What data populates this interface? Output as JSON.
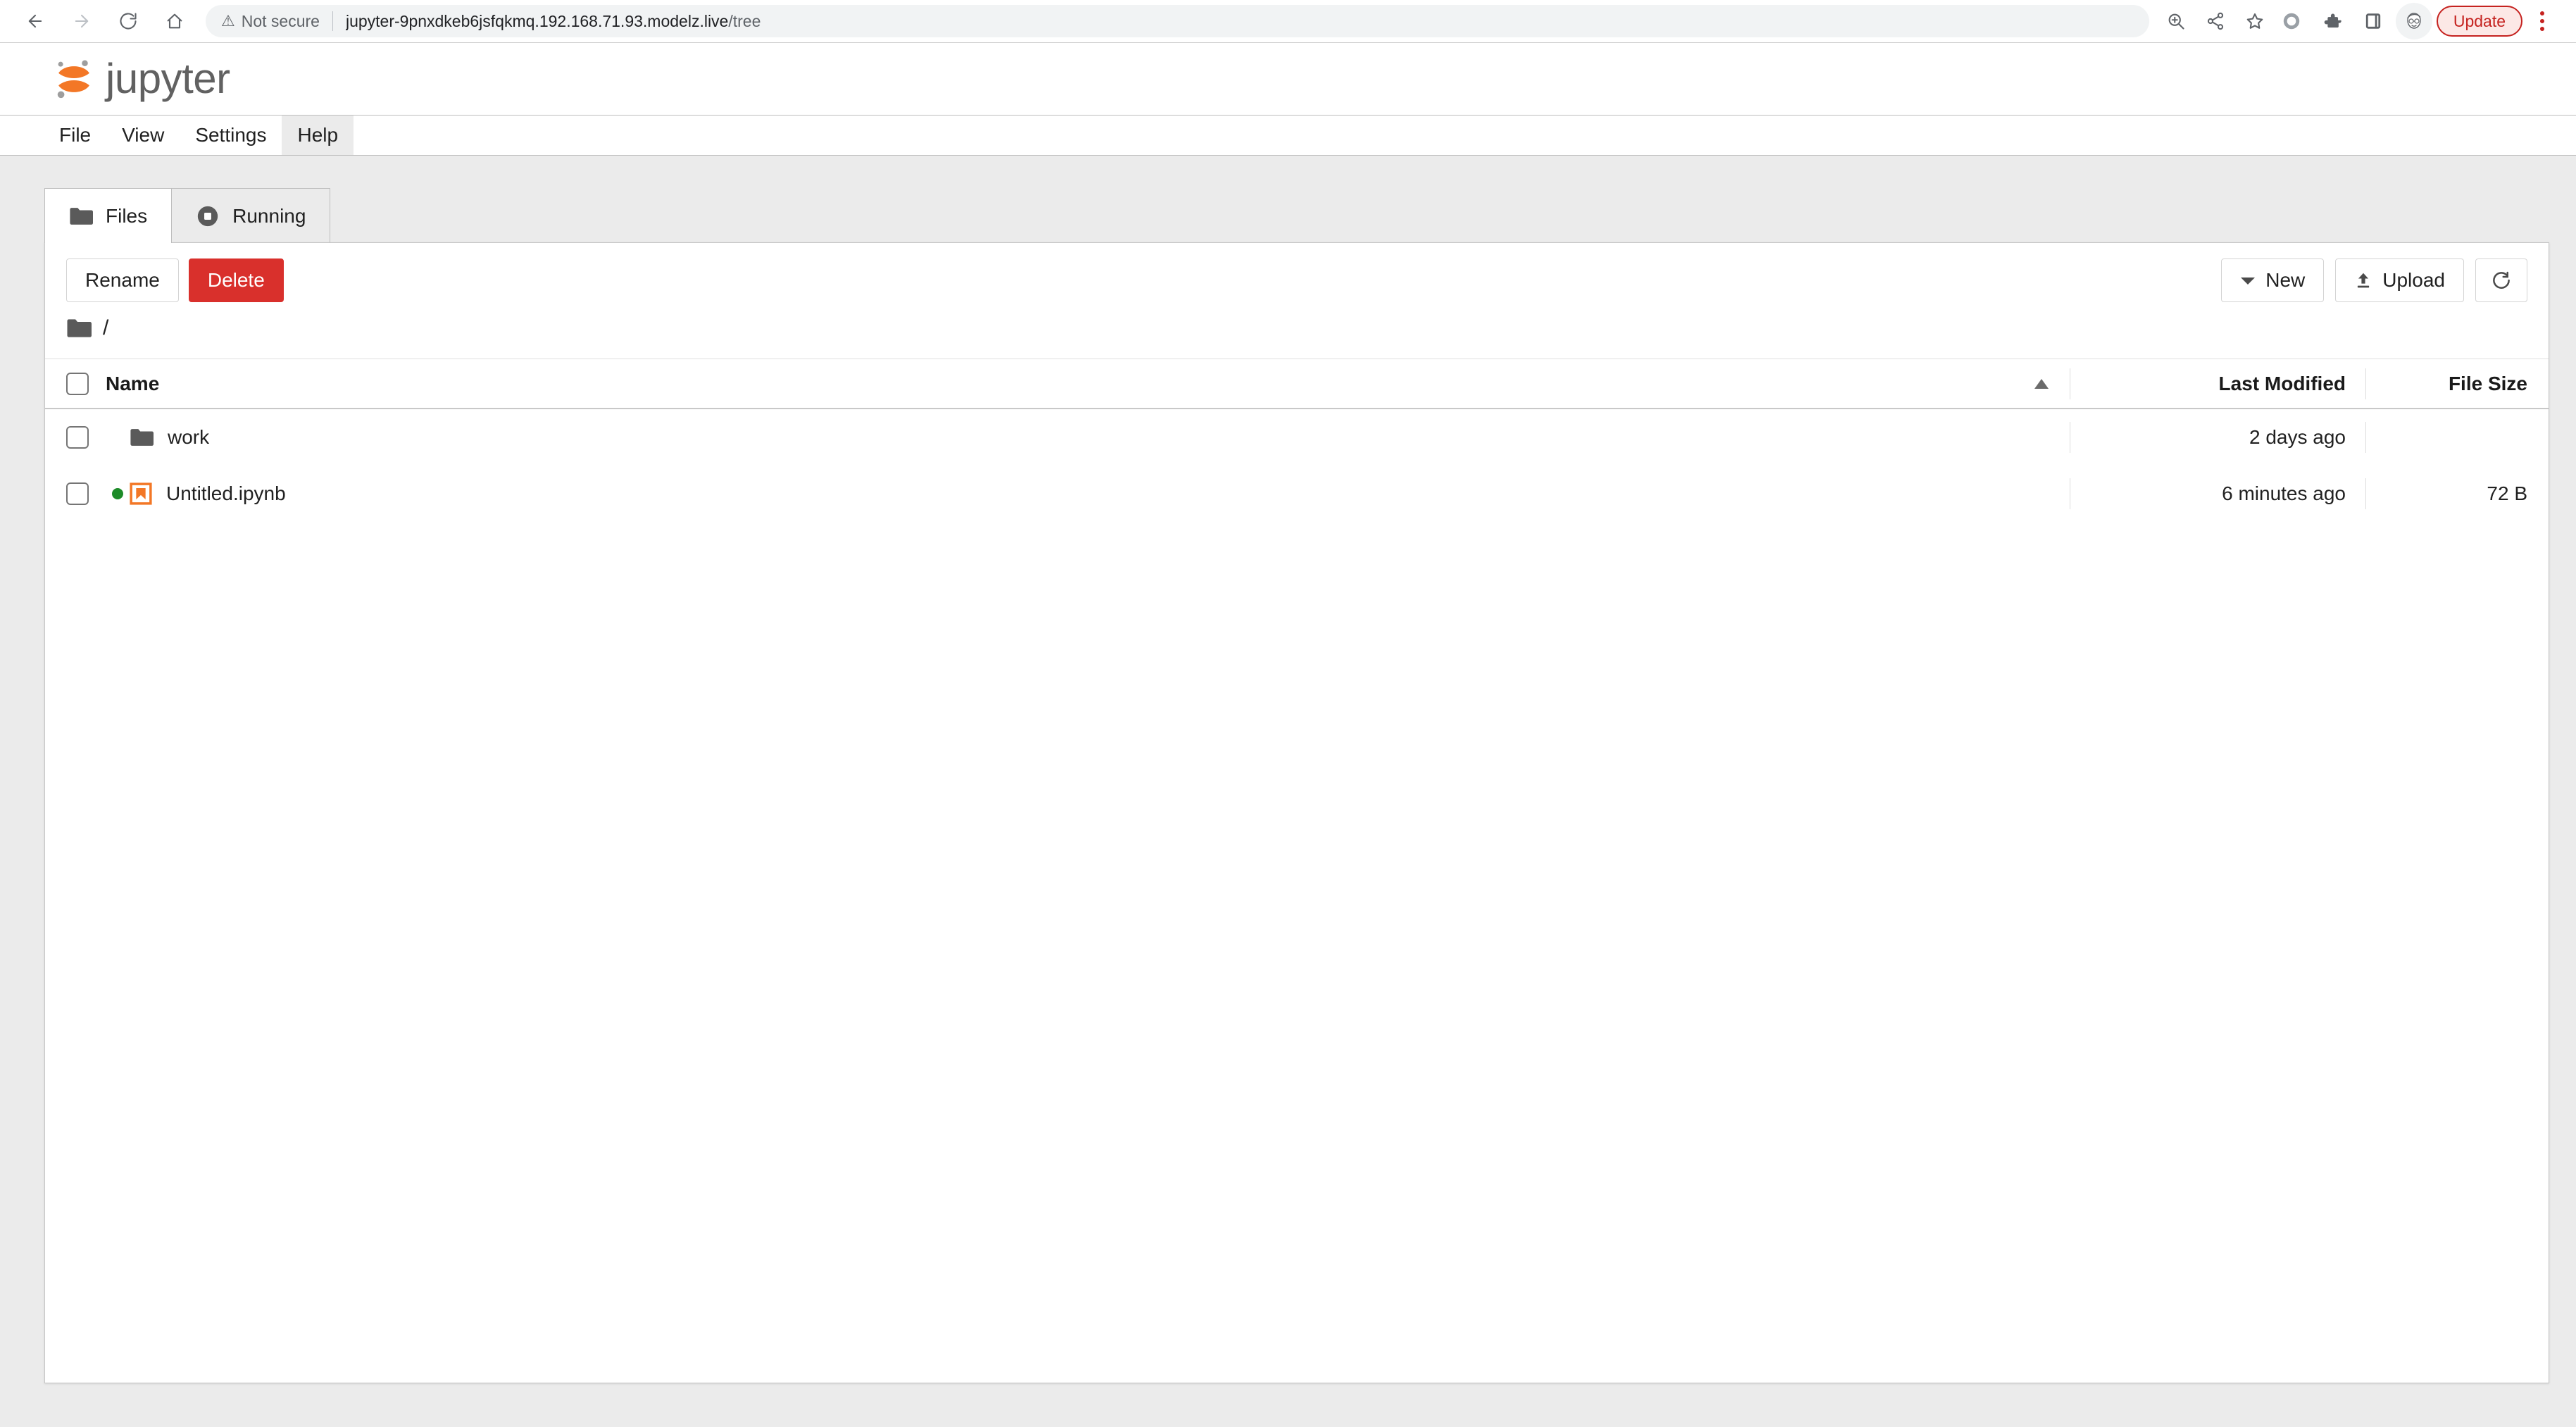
{
  "browser": {
    "back_label": "Back",
    "forward_label": "Forward",
    "reload_label": "Reload",
    "home_label": "Home",
    "security_text": "Not secure",
    "url_host": "jupyter-9pnxdkeb6jsfqkmq.192.168.71.93.modelz.live",
    "url_path": "/tree",
    "zoom_icon_label": "zoom-in-icon",
    "share_icon_label": "share-icon",
    "bookmark_icon_label": "star-icon",
    "profile_icon_label": "circle-icon",
    "extensions_icon_label": "puzzle-icon",
    "sidepanel_icon_label": "side-panel-icon",
    "avatar_label": "avatar",
    "update_label": "Update",
    "menu_label": "Chrome menu"
  },
  "app": {
    "logo_text": "jupyter",
    "accent_orange": "#f37726",
    "menu": [
      {
        "label": "File",
        "hovered": false
      },
      {
        "label": "View",
        "hovered": false
      },
      {
        "label": "Settings",
        "hovered": false
      },
      {
        "label": "Help",
        "hovered": true
      }
    ]
  },
  "tabs": [
    {
      "label": "Files",
      "icon": "folder-icon",
      "active": true
    },
    {
      "label": "Running",
      "icon": "stop-circle-icon",
      "active": false
    }
  ],
  "toolbar": {
    "rename_label": "Rename",
    "delete_label": "Delete",
    "new_label": "New",
    "upload_label": "Upload",
    "refresh_label": "Refresh",
    "delete_color": "#d9302c"
  },
  "breadcrumb": {
    "root_icon": "folder-icon",
    "separator": "/"
  },
  "table": {
    "headers": {
      "name": "Name",
      "last_modified": "Last Modified",
      "file_size": "File Size"
    },
    "sort_direction": "ascending",
    "rows": [
      {
        "name": "work",
        "icon": "folder-icon",
        "running": false,
        "last_modified": "2 days ago",
        "file_size": ""
      },
      {
        "name": "Untitled.ipynb",
        "icon": "notebook-icon",
        "running": true,
        "last_modified": "6 minutes ago",
        "file_size": "72 B"
      }
    ]
  }
}
